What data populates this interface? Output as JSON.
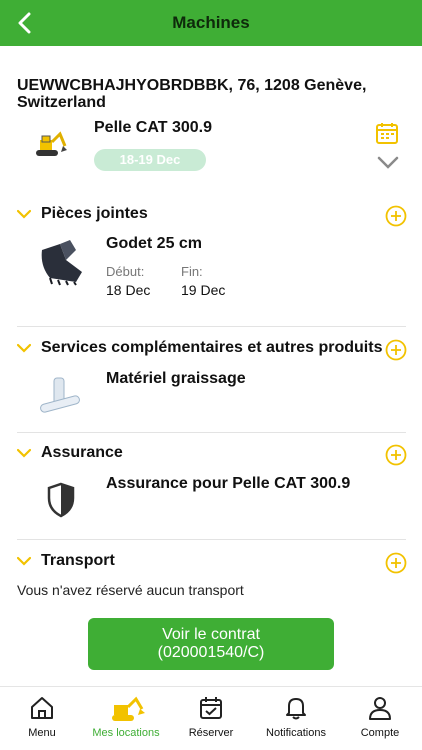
{
  "header": {
    "title": "Machines"
  },
  "order": {
    "address": "UEWWCBHAJHYOBRDBBK, 76, 1208 Genève, Switzerland",
    "machine_name": "Pelle CAT 300.9",
    "dates": "18-19 Dec"
  },
  "sections": {
    "attachments": {
      "label": "Pièces jointes",
      "item_name": "Godet 25 cm",
      "start_label": "Début:",
      "start_value": "18 Dec",
      "end_label": "Fin:",
      "end_value": "19 Dec"
    },
    "services": {
      "label": "Services complémentaires et autres produits",
      "item_name": "Matériel graissage"
    },
    "insurance": {
      "label": "Assurance",
      "item_name": "Assurance pour Pelle CAT 300.9"
    },
    "transport": {
      "label": "Transport",
      "empty_text": "Vous n'avez réservé aucun transport"
    }
  },
  "contract_button": {
    "line1": "Voir le contrat",
    "line2": "(020001540/C)"
  },
  "bottom_nav": [
    {
      "label": "Menu",
      "icon": "home-icon"
    },
    {
      "label": "Mes locations",
      "icon": "excavator-icon",
      "active": true
    },
    {
      "label": "Réserver",
      "icon": "calendar-check-icon"
    },
    {
      "label": "Notifications",
      "icon": "bell-icon"
    },
    {
      "label": "Compte",
      "icon": "user-icon"
    }
  ],
  "colors": {
    "brand_green": "#3fae35",
    "accent_yellow": "#f2c200",
    "badge_bg": "#c9ebd5"
  }
}
